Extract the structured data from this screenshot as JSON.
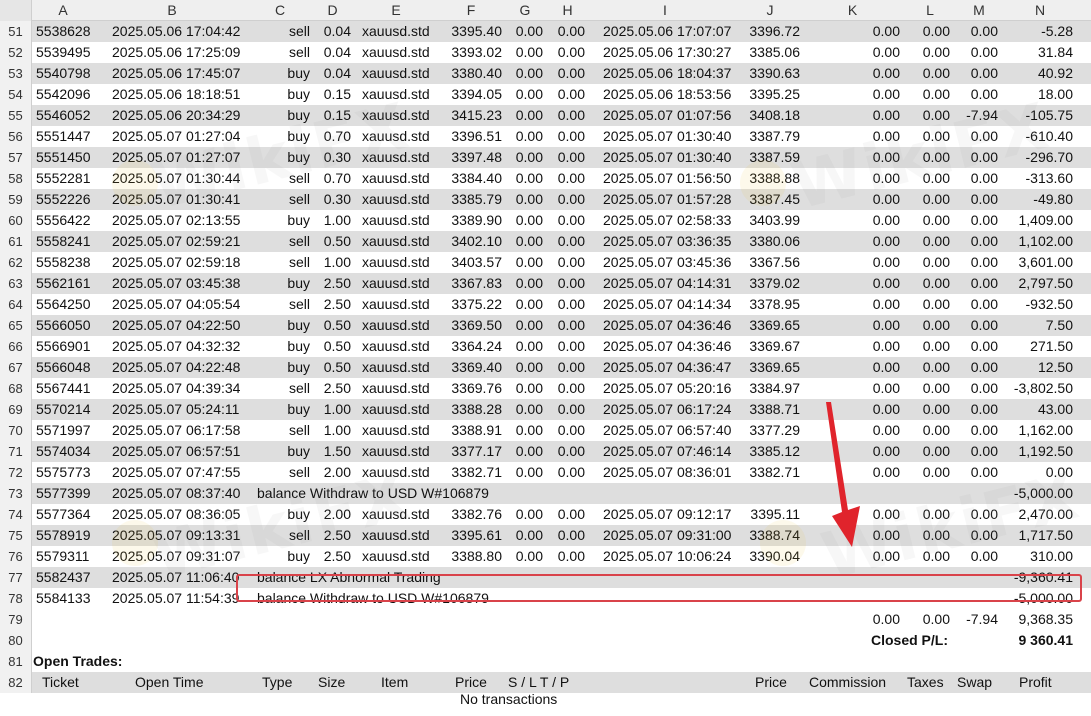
{
  "columns": [
    "A",
    "B",
    "C",
    "D",
    "E",
    "F",
    "G",
    "H",
    "I",
    "J",
    "K",
    "L",
    "M",
    "N"
  ],
  "trades": [
    {
      "row": "51",
      "ticket": "5538628",
      "open": "2025.05.06 17:04:42",
      "type": "sell",
      "size": "0.04",
      "item": "xauusd.std",
      "price": "3395.40",
      "sl": "0.00",
      "tp": "0.00",
      "close": "2025.05.06 17:07:07",
      "cprice": "3396.72",
      "comm": "0.00",
      "tax": "0.00",
      "swap": "0.00",
      "profit": "-5.28"
    },
    {
      "row": "52",
      "ticket": "5539495",
      "open": "2025.05.06 17:25:09",
      "type": "sell",
      "size": "0.04",
      "item": "xauusd.std",
      "price": "3393.02",
      "sl": "0.00",
      "tp": "0.00",
      "close": "2025.05.06 17:30:27",
      "cprice": "3385.06",
      "comm": "0.00",
      "tax": "0.00",
      "swap": "0.00",
      "profit": "31.84"
    },
    {
      "row": "53",
      "ticket": "5540798",
      "open": "2025.05.06 17:45:07",
      "type": "buy",
      "size": "0.04",
      "item": "xauusd.std",
      "price": "3380.40",
      "sl": "0.00",
      "tp": "0.00",
      "close": "2025.05.06 18:04:37",
      "cprice": "3390.63",
      "comm": "0.00",
      "tax": "0.00",
      "swap": "0.00",
      "profit": "40.92"
    },
    {
      "row": "54",
      "ticket": "5542096",
      "open": "2025.05.06 18:18:51",
      "type": "buy",
      "size": "0.15",
      "item": "xauusd.std",
      "price": "3394.05",
      "sl": "0.00",
      "tp": "0.00",
      "close": "2025.05.06 18:53:56",
      "cprice": "3395.25",
      "comm": "0.00",
      "tax": "0.00",
      "swap": "0.00",
      "profit": "18.00"
    },
    {
      "row": "55",
      "ticket": "5546052",
      "open": "2025.05.06 20:34:29",
      "type": "buy",
      "size": "0.15",
      "item": "xauusd.std",
      "price": "3415.23",
      "sl": "0.00",
      "tp": "0.00",
      "close": "2025.05.07 01:07:56",
      "cprice": "3408.18",
      "comm": "0.00",
      "tax": "0.00",
      "swap": "-7.94",
      "profit": "-105.75"
    },
    {
      "row": "56",
      "ticket": "5551447",
      "open": "2025.05.07 01:27:04",
      "type": "buy",
      "size": "0.70",
      "item": "xauusd.std",
      "price": "3396.51",
      "sl": "0.00",
      "tp": "0.00",
      "close": "2025.05.07 01:30:40",
      "cprice": "3387.79",
      "comm": "0.00",
      "tax": "0.00",
      "swap": "0.00",
      "profit": "-610.40"
    },
    {
      "row": "57",
      "ticket": "5551450",
      "open": "2025.05.07 01:27:07",
      "type": "buy",
      "size": "0.30",
      "item": "xauusd.std",
      "price": "3397.48",
      "sl": "0.00",
      "tp": "0.00",
      "close": "2025.05.07 01:30:40",
      "cprice": "3387.59",
      "comm": "0.00",
      "tax": "0.00",
      "swap": "0.00",
      "profit": "-296.70"
    },
    {
      "row": "58",
      "ticket": "5552281",
      "open": "2025.05.07 01:30:44",
      "type": "sell",
      "size": "0.70",
      "item": "xauusd.std",
      "price": "3384.40",
      "sl": "0.00",
      "tp": "0.00",
      "close": "2025.05.07 01:56:50",
      "cprice": "3388.88",
      "comm": "0.00",
      "tax": "0.00",
      "swap": "0.00",
      "profit": "-313.60"
    },
    {
      "row": "59",
      "ticket": "5552226",
      "open": "2025.05.07 01:30:41",
      "type": "sell",
      "size": "0.30",
      "item": "xauusd.std",
      "price": "3385.79",
      "sl": "0.00",
      "tp": "0.00",
      "close": "2025.05.07 01:57:28",
      "cprice": "3387.45",
      "comm": "0.00",
      "tax": "0.00",
      "swap": "0.00",
      "profit": "-49.80"
    },
    {
      "row": "60",
      "ticket": "5556422",
      "open": "2025.05.07 02:13:55",
      "type": "buy",
      "size": "1.00",
      "item": "xauusd.std",
      "price": "3389.90",
      "sl": "0.00",
      "tp": "0.00",
      "close": "2025.05.07 02:58:33",
      "cprice": "3403.99",
      "comm": "0.00",
      "tax": "0.00",
      "swap": "0.00",
      "profit": "1,409.00"
    },
    {
      "row": "61",
      "ticket": "5558241",
      "open": "2025.05.07 02:59:21",
      "type": "sell",
      "size": "0.50",
      "item": "xauusd.std",
      "price": "3402.10",
      "sl": "0.00",
      "tp": "0.00",
      "close": "2025.05.07 03:36:35",
      "cprice": "3380.06",
      "comm": "0.00",
      "tax": "0.00",
      "swap": "0.00",
      "profit": "1,102.00"
    },
    {
      "row": "62",
      "ticket": "5558238",
      "open": "2025.05.07 02:59:18",
      "type": "sell",
      "size": "1.00",
      "item": "xauusd.std",
      "price": "3403.57",
      "sl": "0.00",
      "tp": "0.00",
      "close": "2025.05.07 03:45:36",
      "cprice": "3367.56",
      "comm": "0.00",
      "tax": "0.00",
      "swap": "0.00",
      "profit": "3,601.00"
    },
    {
      "row": "63",
      "ticket": "5562161",
      "open": "2025.05.07 03:45:38",
      "type": "buy",
      "size": "2.50",
      "item": "xauusd.std",
      "price": "3367.83",
      "sl": "0.00",
      "tp": "0.00",
      "close": "2025.05.07 04:14:31",
      "cprice": "3379.02",
      "comm": "0.00",
      "tax": "0.00",
      "swap": "0.00",
      "profit": "2,797.50"
    },
    {
      "row": "64",
      "ticket": "5564250",
      "open": "2025.05.07 04:05:54",
      "type": "sell",
      "size": "2.50",
      "item": "xauusd.std",
      "price": "3375.22",
      "sl": "0.00",
      "tp": "0.00",
      "close": "2025.05.07 04:14:34",
      "cprice": "3378.95",
      "comm": "0.00",
      "tax": "0.00",
      "swap": "0.00",
      "profit": "-932.50"
    },
    {
      "row": "65",
      "ticket": "5566050",
      "open": "2025.05.07 04:22:50",
      "type": "buy",
      "size": "0.50",
      "item": "xauusd.std",
      "price": "3369.50",
      "sl": "0.00",
      "tp": "0.00",
      "close": "2025.05.07 04:36:46",
      "cprice": "3369.65",
      "comm": "0.00",
      "tax": "0.00",
      "swap": "0.00",
      "profit": "7.50"
    },
    {
      "row": "66",
      "ticket": "5566901",
      "open": "2025.05.07 04:32:32",
      "type": "buy",
      "size": "0.50",
      "item": "xauusd.std",
      "price": "3364.24",
      "sl": "0.00",
      "tp": "0.00",
      "close": "2025.05.07 04:36:46",
      "cprice": "3369.67",
      "comm": "0.00",
      "tax": "0.00",
      "swap": "0.00",
      "profit": "271.50"
    },
    {
      "row": "67",
      "ticket": "5566048",
      "open": "2025.05.07 04:22:48",
      "type": "buy",
      "size": "0.50",
      "item": "xauusd.std",
      "price": "3369.40",
      "sl": "0.00",
      "tp": "0.00",
      "close": "2025.05.07 04:36:47",
      "cprice": "3369.65",
      "comm": "0.00",
      "tax": "0.00",
      "swap": "0.00",
      "profit": "12.50"
    },
    {
      "row": "68",
      "ticket": "5567441",
      "open": "2025.05.07 04:39:34",
      "type": "sell",
      "size": "2.50",
      "item": "xauusd.std",
      "price": "3369.76",
      "sl": "0.00",
      "tp": "0.00",
      "close": "2025.05.07 05:20:16",
      "cprice": "3384.97",
      "comm": "0.00",
      "tax": "0.00",
      "swap": "0.00",
      "profit": "-3,802.50"
    },
    {
      "row": "69",
      "ticket": "5570214",
      "open": "2025.05.07 05:24:11",
      "type": "buy",
      "size": "1.00",
      "item": "xauusd.std",
      "price": "3388.28",
      "sl": "0.00",
      "tp": "0.00",
      "close": "2025.05.07 06:17:24",
      "cprice": "3388.71",
      "comm": "0.00",
      "tax": "0.00",
      "swap": "0.00",
      "profit": "43.00"
    },
    {
      "row": "70",
      "ticket": "5571997",
      "open": "2025.05.07 06:17:58",
      "type": "sell",
      "size": "1.00",
      "item": "xauusd.std",
      "price": "3388.91",
      "sl": "0.00",
      "tp": "0.00",
      "close": "2025.05.07 06:57:40",
      "cprice": "3377.29",
      "comm": "0.00",
      "tax": "0.00",
      "swap": "0.00",
      "profit": "1,162.00"
    },
    {
      "row": "71",
      "ticket": "5574034",
      "open": "2025.05.07 06:57:51",
      "type": "buy",
      "size": "1.50",
      "item": "xauusd.std",
      "price": "3377.17",
      "sl": "0.00",
      "tp": "0.00",
      "close": "2025.05.07 07:46:14",
      "cprice": "3385.12",
      "comm": "0.00",
      "tax": "0.00",
      "swap": "0.00",
      "profit": "1,192.50"
    },
    {
      "row": "72",
      "ticket": "5575773",
      "open": "2025.05.07 07:47:55",
      "type": "sell",
      "size": "2.00",
      "item": "xauusd.std",
      "price": "3382.71",
      "sl": "0.00",
      "tp": "0.00",
      "close": "2025.05.07 08:36:01",
      "cprice": "3382.71",
      "comm": "0.00",
      "tax": "0.00",
      "swap": "0.00",
      "profit": "0.00"
    },
    {
      "row": "73",
      "ticket": "5577399",
      "open": "2025.05.07 08:37:40",
      "balance": "balance Withdraw to USD W#106879",
      "profit": "-5,000.00"
    },
    {
      "row": "74",
      "ticket": "5577364",
      "open": "2025.05.07 08:36:05",
      "type": "buy",
      "size": "2.00",
      "item": "xauusd.std",
      "price": "3382.76",
      "sl": "0.00",
      "tp": "0.00",
      "close": "2025.05.07 09:12:17",
      "cprice": "3395.11",
      "comm": "0.00",
      "tax": "0.00",
      "swap": "0.00",
      "profit": "2,470.00"
    },
    {
      "row": "75",
      "ticket": "5578919",
      "open": "2025.05.07 09:13:31",
      "type": "sell",
      "size": "2.50",
      "item": "xauusd.std",
      "price": "3395.61",
      "sl": "0.00",
      "tp": "0.00",
      "close": "2025.05.07 09:31:00",
      "cprice": "3388.74",
      "comm": "0.00",
      "tax": "0.00",
      "swap": "0.00",
      "profit": "1,717.50"
    },
    {
      "row": "76",
      "ticket": "5579311",
      "open": "2025.05.07 09:31:07",
      "type": "buy",
      "size": "2.50",
      "item": "xauusd.std",
      "price": "3388.80",
      "sl": "0.00",
      "tp": "0.00",
      "close": "2025.05.07 10:06:24",
      "cprice": "3390.04",
      "comm": "0.00",
      "tax": "0.00",
      "swap": "0.00",
      "profit": "310.00"
    },
    {
      "row": "77",
      "ticket": "5582437",
      "open": "2025.05.07 11:06:40",
      "balance": "balance LX Abnormal Trading",
      "profit": "-9,360.41"
    },
    {
      "row": "78",
      "ticket": "5584133",
      "open": "2025.05.07 11:54:39",
      "balance": "balance Withdraw to USD W#106879",
      "profit": "-5,000.00"
    }
  ],
  "totals": {
    "row": "79",
    "comm": "0.00",
    "tax": "0.00",
    "swap": "-7.94",
    "profit": "9,368.35"
  },
  "closed_pl": {
    "row": "80",
    "label": "Closed P/L:",
    "value": "9 360.41"
  },
  "open_trades": {
    "row": "81",
    "label": "Open Trades:"
  },
  "open_headers": {
    "row": "82",
    "ticket": "Ticket",
    "open": "Open Time",
    "type": "Type",
    "size": "Size",
    "item": "Item",
    "price": "Price",
    "sltp": "S / L   T / P",
    "price2": "Price",
    "comm": "Commission",
    "tax": "Taxes",
    "swap": "Swap",
    "profit": "Profit"
  },
  "no_transactions": "No transactions",
  "watermark": "WikiFX",
  "colors": {
    "highlight_border": "#d9434a",
    "arrow": "#e0242c",
    "shade": "#dedede"
  }
}
